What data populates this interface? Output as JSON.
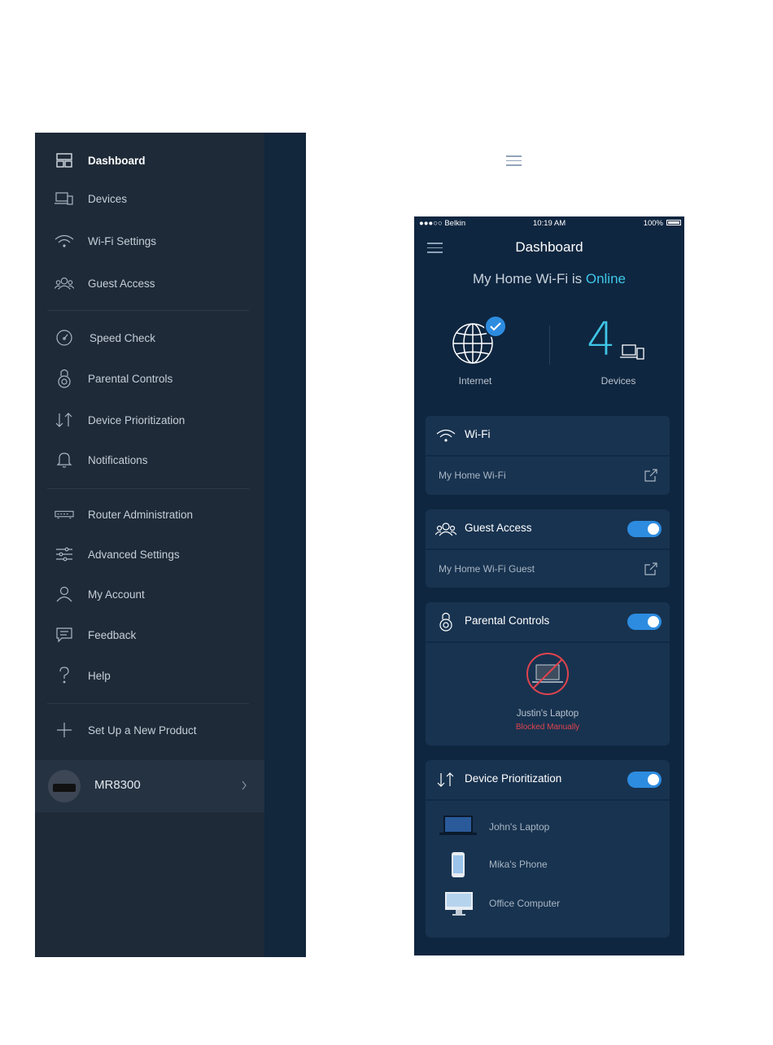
{
  "menu": {
    "items": [
      {
        "label": "Dashboard",
        "icon": "dashboard-icon",
        "active": true
      },
      {
        "label": "Devices",
        "icon": "devices-icon"
      },
      {
        "label": "Wi-Fi Settings",
        "icon": "wifi-icon"
      },
      {
        "label": "Guest Access",
        "icon": "guest-icon"
      },
      {
        "label": "Speed Check",
        "icon": "speedometer-icon"
      },
      {
        "label": "Parental Controls",
        "icon": "lock-icon"
      },
      {
        "label": "Device Prioritization",
        "icon": "arrows-icon"
      },
      {
        "label": "Notifications",
        "icon": "bell-icon"
      },
      {
        "label": "Router Administration",
        "icon": "router-icon"
      },
      {
        "label": "Advanced Settings",
        "icon": "sliders-icon"
      },
      {
        "label": "My Account",
        "icon": "user-icon"
      },
      {
        "label": "Feedback",
        "icon": "chat-icon"
      },
      {
        "label": "Help",
        "icon": "question-icon"
      },
      {
        "label": "Set Up a New Product",
        "icon": "plus-icon"
      }
    ],
    "product": {
      "label": "MR8300"
    }
  },
  "phone": {
    "status": {
      "carrier": "●●●○○ Belkin",
      "time": "10:19 AM",
      "battery": "100%"
    },
    "title": "Dashboard",
    "network_status": {
      "prefix": "My Home Wi-Fi is",
      "state": "Online"
    },
    "internet_label": "Internet",
    "devices_count": "4",
    "devices_label": "Devices",
    "wifi": {
      "title": "Wi-Fi",
      "network": "My Home Wi-Fi"
    },
    "guest": {
      "title": "Guest Access",
      "network": "My Home Wi-Fi Guest",
      "enabled": true
    },
    "parental": {
      "title": "Parental Controls",
      "enabled": true,
      "device": "Justin's Laptop",
      "state": "Blocked Manually"
    },
    "prioritization": {
      "title": "Device Prioritization",
      "enabled": true,
      "devices": [
        {
          "name": "John's Laptop",
          "icon": "laptop-icon"
        },
        {
          "name": "Mika's Phone",
          "icon": "phone-icon"
        },
        {
          "name": "Office Computer",
          "icon": "desktop-icon"
        }
      ]
    },
    "colors": {
      "accent": "#3fc6e7",
      "toggle": "#2d8ce0",
      "blocked": "#e0434d",
      "background": "#0f2640"
    }
  }
}
